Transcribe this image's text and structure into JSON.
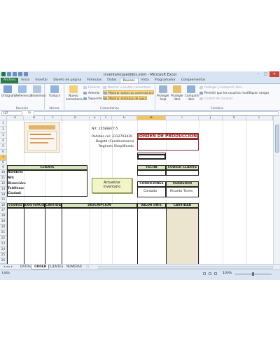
{
  "window": {
    "title": "inventarioypedidos.xlsm - Microsoft Excel"
  },
  "ribbon_tabs": [
    "Archivo",
    "Inicio",
    "Insertar",
    "Diseño de página",
    "Fórmulas",
    "Datos",
    "Revisar",
    "Vista",
    "Programador",
    "Complementos"
  ],
  "ribbon": {
    "revision": {
      "label": "Revisión",
      "ortografia": "Ortografía",
      "referencia": "Referencia",
      "sinonimos": "Sinónimos"
    },
    "idioma": {
      "label": "Idioma",
      "traducir": "Traducir"
    },
    "comentarios": {
      "label": "Comentarios",
      "nuevo": "Nuevo comentario",
      "eliminar": "Eliminar",
      "anterior": "Anterior",
      "siguiente": "Siguiente",
      "mostrar_ocultar": "Mostrar u ocultar comentario",
      "mostrar_todos": "Mostrar todos los comentarios",
      "mostrar_entradas": "Mostrar entradas de lápiz"
    },
    "cambios": {
      "label": "Cambios",
      "proteger_hoja": "Proteger hoja",
      "proteger_libro": "Proteger libro",
      "compartir_libro": "Compartir libro",
      "proteger_compartir": "Proteger y compartir libro",
      "permitir": "Permitir que los usuarios modifiquen rangos",
      "control": "Control de cambios"
    }
  },
  "formula_bar": {
    "name_box": "H7",
    "fx": "fx",
    "value": ""
  },
  "columns": [
    "A",
    "B",
    "C",
    "D",
    "E",
    "F",
    "G",
    "H",
    "I",
    "J",
    "K",
    "L"
  ],
  "rows": [
    "1",
    "2",
    "3",
    "4",
    "5",
    "6",
    "7",
    "8",
    "9",
    "10",
    "11",
    "12",
    "13",
    "14",
    "15",
    "16",
    "17",
    "18",
    "19",
    "20",
    "21",
    "22",
    "23",
    "24",
    "25",
    "26"
  ],
  "sheet": {
    "nit": "Nit: 25588877-5",
    "pedidos": "Pedidos cel: 3112703420",
    "ciudad": "Bogotá (Cundinamarca)",
    "regimen": "Regimen Simplificado",
    "orden": "ORDEN DE PRODUCCION",
    "cliente_hdr": "CLIENTE",
    "nombre": "Nombre:",
    "nit_label": "Nit:",
    "direccion": "Dirección:",
    "telefono": "Teléfono:",
    "ciudad_label": "Ciudad:",
    "fecha": "FECHA",
    "codigo_cliente": "CODIGO CLIENTE",
    "condiciones": "CONDICIONES",
    "vendedor": "VENDEDOR",
    "contado": "Contado",
    "vendedor_name": "Ricardo Torres",
    "actualizar": "Actualizar",
    "inventario": "Inventario",
    "table_headers": [
      "CODIGO",
      "EXISTENCIA",
      "CANTIDAD",
      "DESCRIPCIÓN",
      "VALOR UNIT.",
      "CANTIDAD"
    ]
  },
  "sheet_tabs": [
    "DATOS",
    "ORDEN",
    "CLIENTES",
    "NUMERAR"
  ],
  "status": {
    "mode": "Listo",
    "zoom": "100%"
  }
}
